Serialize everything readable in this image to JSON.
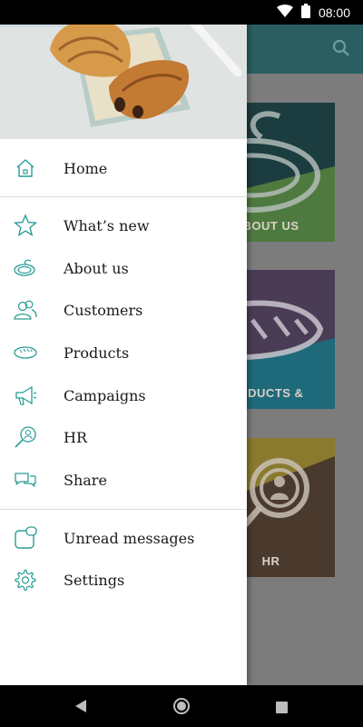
{
  "status_bar": {
    "time": "08:00",
    "icons": [
      "wifi-icon",
      "battery-icon"
    ]
  },
  "app_bar": {
    "icons": [
      "search-icon"
    ],
    "color": "#2a5e61"
  },
  "tiles": [
    {
      "label": "BOUT US"
    },
    {
      "label": "ODUCTS &"
    },
    {
      "label": "HR"
    }
  ],
  "drawer": {
    "accent": "#2a9d95",
    "items": [
      {
        "label": "Home",
        "icon": "home-icon"
      },
      {
        "label": "What’s new",
        "icon": "star-icon"
      },
      {
        "label": "About us",
        "icon": "swirl-icon"
      },
      {
        "label": "Customers",
        "icon": "people-icon"
      },
      {
        "label": "Products",
        "icon": "bread-icon"
      },
      {
        "label": "Campaigns",
        "icon": "megaphone-icon"
      },
      {
        "label": "HR",
        "icon": "magnifier-person-icon"
      },
      {
        "label": "Share",
        "icon": "chat-bubbles-icon"
      },
      {
        "label": "Unread messages",
        "icon": "message-icon"
      },
      {
        "label": "Settings",
        "icon": "gear-icon"
      }
    ]
  },
  "nav_bar": {
    "icons": [
      "back-icon",
      "home-circle-icon",
      "recents-icon"
    ]
  }
}
